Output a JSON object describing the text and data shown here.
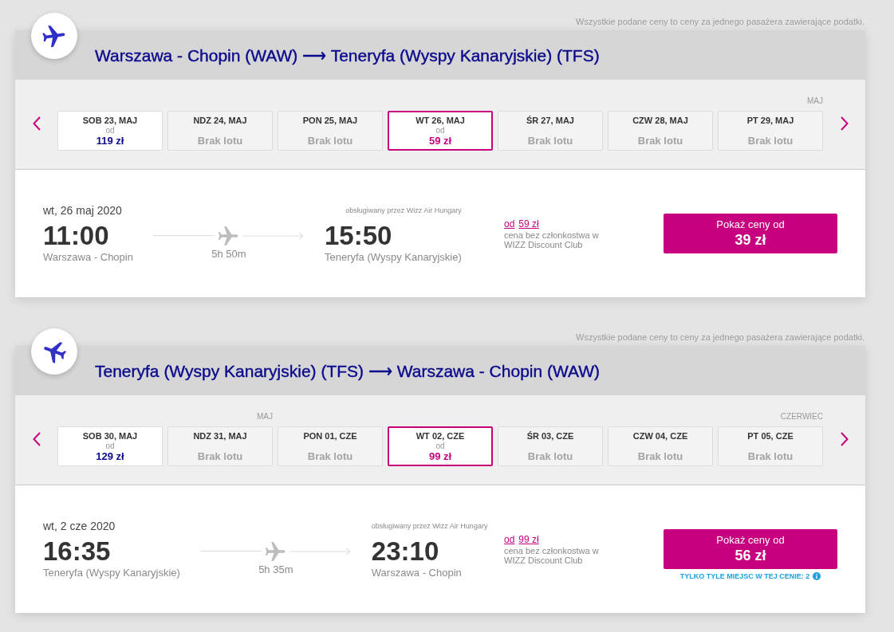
{
  "sections": [
    {
      "kind": "outbound",
      "note": "Wszystkie podane ceny to ceny za jednego pasażera zawierające podatki.",
      "route_title": "Warszawa - Chopin (WAW) ⟶ Teneryfa (Wyspy Kanaryjskie) (TFS)",
      "dates": [
        {
          "label": "SOB 23, MAJ",
          "available": true,
          "from": "od",
          "price": "119 zł",
          "selected": false
        },
        {
          "label": "NDZ 24, MAJ",
          "available": false,
          "status": "Brak lotu",
          "selected": false
        },
        {
          "label": "PON 25, MAJ",
          "available": false,
          "status": "Brak lotu",
          "selected": false
        },
        {
          "label": "WT 26, MAJ",
          "available": true,
          "from": "od",
          "price": "59 zł",
          "selected": true
        },
        {
          "label": "ŚR 27, MAJ",
          "available": false,
          "status": "Brak lotu",
          "selected": false
        },
        {
          "label": "CZW 28, MAJ",
          "available": false,
          "status": "Brak lotu",
          "selected": false
        },
        {
          "label": "PT 29, MAJ",
          "month_label": "MAJ",
          "available": false,
          "status": "Brak lotu",
          "selected": false
        }
      ],
      "flight": {
        "date": "wt, 26 maj 2020",
        "departure_time": "11:00",
        "departure_city": "Warszawa - Chopin",
        "duration": "5h 50m",
        "operated_by": "obsługiwany przez Wizz Air Hungary",
        "arrival_time": "15:50",
        "arrival_city": "Teneryfa (Wyspy Kanaryjskie)",
        "regular_price_from": "od",
        "regular_price": "59 zł",
        "regular_price_note": "cena bez członkostwa w WIZZ Discount Club",
        "button": {
          "label": "Pokaż ceny od",
          "price": "39 zł"
        }
      }
    },
    {
      "kind": "return",
      "note": "Wszystkie podane ceny to ceny za jednego pasażera zawierające podatki.",
      "route_title": "Teneryfa (Wyspy Kanaryjskie) (TFS) ⟶ Warszawa - Chopin (WAW)",
      "dates": [
        {
          "label": "SOB 30, MAJ",
          "available": true,
          "from": "od",
          "price": "129 zł",
          "selected": false
        },
        {
          "label": "NDZ 31, MAJ",
          "month_label": "MAJ",
          "available": false,
          "status": "Brak lotu",
          "selected": false
        },
        {
          "label": "PON 01, CZE",
          "available": false,
          "status": "Brak lotu",
          "selected": false
        },
        {
          "label": "WT 02, CZE",
          "available": true,
          "from": "od",
          "price": "99 zł",
          "selected": true
        },
        {
          "label": "ŚR 03, CZE",
          "available": false,
          "status": "Brak lotu",
          "selected": false
        },
        {
          "label": "CZW 04, CZE",
          "available": false,
          "status": "Brak lotu",
          "selected": false
        },
        {
          "label": "PT 05, CZE",
          "month_label": "CZERWIEC",
          "available": false,
          "status": "Brak lotu",
          "selected": false
        }
      ],
      "flight": {
        "date": "wt, 2 cze 2020",
        "departure_time": "16:35",
        "departure_city": "Teneryfa (Wyspy Kanaryjskie)",
        "duration": "5h 35m",
        "operated_by": "obsługiwany przez Wizz Air Hungary",
        "arrival_time": "23:10",
        "arrival_city": "Warszawa - Chopin",
        "regular_price_from": "od",
        "regular_price": "99 zł",
        "regular_price_note": "cena bez członkostwa w WIZZ Discount Club",
        "button": {
          "label": "Pokaż ceny od",
          "price": "56 zł"
        },
        "seats_note": "TYLKO TYLE MIEJSC W TEJ CENIE: 2"
      }
    }
  ]
}
